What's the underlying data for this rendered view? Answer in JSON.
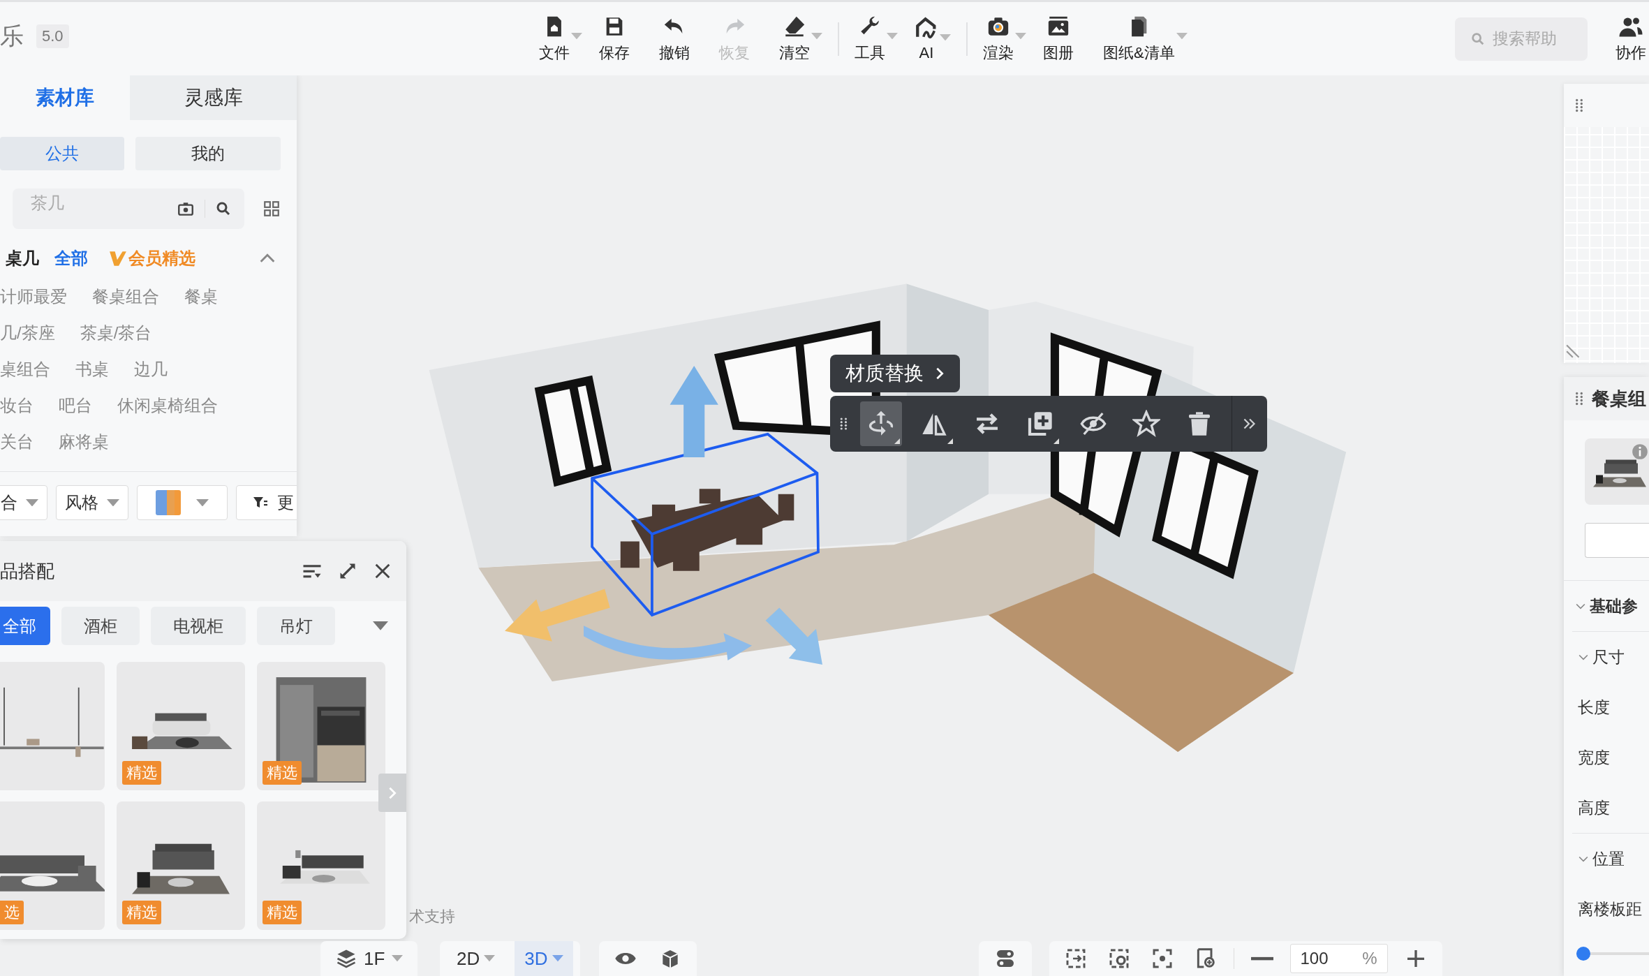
{
  "app": {
    "logo": "乐",
    "version": "5.0"
  },
  "toolbar_groups": [
    [
      {
        "kind": "file",
        "label": "文件",
        "dropdown": true,
        "disabled": false
      },
      {
        "kind": "save",
        "label": "保存",
        "dropdown": false,
        "disabled": false
      },
      {
        "kind": "undo",
        "label": "撤销",
        "dropdown": false,
        "disabled": false
      },
      {
        "kind": "redo",
        "label": "恢复",
        "dropdown": false,
        "disabled": true
      },
      {
        "kind": "clear",
        "label": "清空",
        "dropdown": true,
        "disabled": false
      }
    ],
    [
      {
        "kind": "tools",
        "label": "工具",
        "dropdown": true,
        "disabled": false
      },
      {
        "kind": "ai",
        "label": "AI",
        "dropdown": true,
        "disabled": false
      }
    ],
    [
      {
        "kind": "render",
        "label": "渲染",
        "dropdown": true,
        "disabled": false
      },
      {
        "kind": "album",
        "label": "图册",
        "dropdown": false,
        "disabled": false
      },
      {
        "kind": "drawings",
        "label": "图纸&清单",
        "dropdown": true,
        "disabled": false
      }
    ]
  ],
  "help_search": {
    "placeholder": "搜索帮助"
  },
  "collaborate": {
    "label": "协作"
  },
  "library": {
    "tabs": [
      {
        "label": "素材库",
        "selected": true
      },
      {
        "label": "灵感库",
        "selected": false
      }
    ],
    "scopes": [
      {
        "label": "公共",
        "selected": true
      },
      {
        "label": "我的",
        "selected": false
      }
    ],
    "search": {
      "placeholder": "茶几"
    },
    "category": {
      "title": "桌几",
      "all": "全部",
      "vip": "会员精选",
      "expanded": true
    },
    "tag_rows": [
      [
        "计师最爱",
        "餐桌组合",
        "餐桌"
      ],
      [
        "几/茶座",
        "茶桌/茶台"
      ],
      [
        "桌组合",
        "书桌",
        "边几"
      ],
      [
        "妆台",
        "吧台",
        "休闲桌椅组合"
      ],
      [
        "关台",
        "麻将桌"
      ]
    ],
    "filters": [
      {
        "kind": "select",
        "label": "合"
      },
      {
        "kind": "select",
        "label": "风格"
      },
      {
        "kind": "color"
      },
      {
        "kind": "button",
        "label": "更"
      }
    ]
  },
  "match_panel": {
    "title": "品搭配",
    "chips": [
      {
        "label": "全部",
        "selected": true
      },
      {
        "label": "酒柜",
        "selected": false
      },
      {
        "label": "电视柜",
        "selected": false
      },
      {
        "label": "吊灯",
        "selected": false
      }
    ],
    "cards": [
      {
        "kind": "picture"
      },
      {
        "kind": "picture",
        "badge": "精选"
      },
      {
        "kind": "picture",
        "badge": "精选"
      },
      {
        "kind": "picture",
        "badge": "选"
      },
      {
        "kind": "picture",
        "badge": "精选"
      },
      {
        "kind": "picture",
        "badge": "精选"
      }
    ]
  },
  "canvas": {
    "material_button": "材质替换",
    "object_tools": [
      {
        "kind": "move",
        "selected": true,
        "submenu": true
      },
      {
        "kind": "mirror",
        "selected": false,
        "submenu": true
      },
      {
        "kind": "swap",
        "selected": false,
        "submenu": false
      },
      {
        "kind": "copy",
        "selected": false,
        "submenu": true
      },
      {
        "kind": "hide",
        "selected": false,
        "submenu": false
      },
      {
        "kind": "favorite",
        "selected": false,
        "submenu": false
      },
      {
        "kind": "delete",
        "selected": false,
        "submenu": false
      }
    ],
    "support_text": "术支持"
  },
  "bottom_bar": {
    "floor": "1F",
    "views": [
      {
        "label": "2D",
        "selected": false
      },
      {
        "label": "3D",
        "selected": true
      }
    ],
    "zoom": "100",
    "zoom_unit": "%"
  },
  "right_panel": {
    "title": "餐桌组",
    "sections": [
      {
        "kind": "group",
        "title": "基础参",
        "expanded": true
      },
      {
        "kind": "subgroup",
        "title": "尺寸",
        "expanded": true,
        "fields": [
          "长度",
          "宽度",
          "高度"
        ]
      },
      {
        "kind": "subgroup",
        "title": "位置",
        "expanded": true,
        "fields": [
          "离楼板距"
        ]
      }
    ],
    "slider": {
      "level": 0
    }
  }
}
